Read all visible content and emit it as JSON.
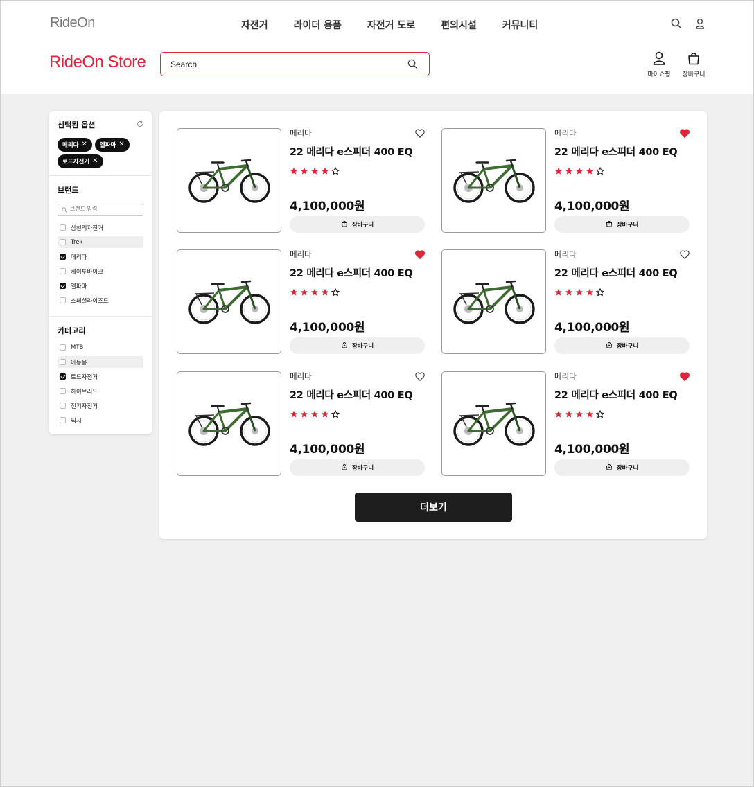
{
  "header": {
    "logo": "RideOn",
    "nav": [
      "자전거",
      "라이더 용품",
      "자전거 도로",
      "편의시설",
      "커뮤니티"
    ],
    "icons": [
      "search-icon",
      "user-icon"
    ]
  },
  "store": {
    "title": "RideOn Store",
    "search_placeholder": "Search",
    "my_shopping": "마이쇼핑",
    "cart": "장바구니"
  },
  "filters": {
    "selected_title": "선택된 옵션",
    "chips": [
      "메리다",
      "엘파마",
      "로드자전거"
    ],
    "brand_title": "브랜드",
    "brand_search_placeholder": "브랜드 입력",
    "brands": [
      {
        "label": "삼천리자전거",
        "checked": false,
        "highlight": false
      },
      {
        "label": "Trek",
        "checked": false,
        "highlight": true
      },
      {
        "label": "메리다",
        "checked": true,
        "highlight": false
      },
      {
        "label": "케이투바이크",
        "checked": false,
        "highlight": false
      },
      {
        "label": "엘파마",
        "checked": true,
        "highlight": false
      },
      {
        "label": "스페셜라이즈드",
        "checked": false,
        "highlight": false
      }
    ],
    "category_title": "카테고리",
    "categories": [
      {
        "label": "MTB",
        "checked": false,
        "highlight": false
      },
      {
        "label": "아동용",
        "checked": false,
        "highlight": true
      },
      {
        "label": "로드자전거",
        "checked": true,
        "highlight": false
      },
      {
        "label": "하이브리드",
        "checked": false,
        "highlight": false
      },
      {
        "label": "전기자전거",
        "checked": false,
        "highlight": false
      },
      {
        "label": "픽시",
        "checked": false,
        "highlight": false
      }
    ]
  },
  "products": [
    {
      "brand": "메리다",
      "name": "22 메리다 e스피더 400 EQ",
      "rating": 4,
      "max_rating": 5,
      "price": "4,100,000원",
      "liked": false,
      "cart_label": "장바구니"
    },
    {
      "brand": "메리다",
      "name": "22 메리다 e스피더 400 EQ",
      "rating": 4,
      "max_rating": 5,
      "price": "4,100,000원",
      "liked": true,
      "cart_label": "장바구니"
    },
    {
      "brand": "메리다",
      "name": "22 메리다 e스피더 400 EQ",
      "rating": 4,
      "max_rating": 5,
      "price": "4,100,000원",
      "liked": true,
      "cart_label": "장바구니"
    },
    {
      "brand": "메리다",
      "name": "22 메리다 e스피더 400 EQ",
      "rating": 4,
      "max_rating": 5,
      "price": "4,100,000원",
      "liked": false,
      "cart_label": "장바구니"
    },
    {
      "brand": "메리다",
      "name": "22 메리다 e스피더 400 EQ",
      "rating": 4,
      "max_rating": 5,
      "price": "4,100,000원",
      "liked": false,
      "cart_label": "장바구니"
    },
    {
      "brand": "메리다",
      "name": "22 메리다 e스피더 400 EQ",
      "rating": 4,
      "max_rating": 5,
      "price": "4,100,000원",
      "liked": true,
      "cart_label": "장바구니"
    }
  ],
  "more_label": "더보기",
  "colors": {
    "accent": "#e0243c",
    "dark": "#1e1e1e",
    "bike_green": "#3e6b32"
  }
}
